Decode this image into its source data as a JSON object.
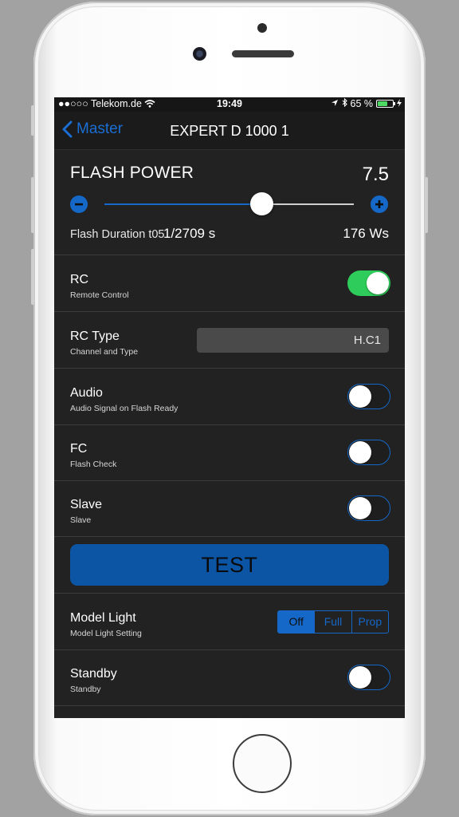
{
  "status_bar": {
    "carrier": "●●○○○ Telekom.de",
    "time": "19:49",
    "battery": "65 %",
    "battery_level": 0.65
  },
  "nav": {
    "back_label": "Master",
    "title": "EXPERT D 1000 1"
  },
  "flash_power": {
    "label": "FLASH POWER",
    "value": "7.5",
    "slider_level": 0.63,
    "duration_label": "Flash Duration t05",
    "duration_value": "1/2709 s",
    "energy": "176 Ws"
  },
  "settings": {
    "rc": {
      "title": "RC",
      "subtitle": "Remote Control",
      "on": true
    },
    "rc_type": {
      "title": "RC Type",
      "subtitle": "Channel and Type",
      "value": "H.C1"
    },
    "audio": {
      "title": "Audio",
      "subtitle": "Audio Signal on Flash Ready",
      "on": false
    },
    "fc": {
      "title": "FC",
      "subtitle": "Flash Check",
      "on": false
    },
    "slave": {
      "title": "Slave",
      "subtitle": "Slave",
      "on": false
    },
    "test_label": "TEST",
    "model_light": {
      "title": "Model Light",
      "subtitle": "Model Light Setting",
      "options": [
        "Off",
        "Full",
        "Prop"
      ],
      "selected": "Off"
    },
    "standby": {
      "title": "Standby",
      "subtitle": "Standby",
      "on": false
    }
  },
  "colors": {
    "accent": "#1568c8",
    "toggle_on": "#2ecc5a",
    "background": "#222222"
  }
}
